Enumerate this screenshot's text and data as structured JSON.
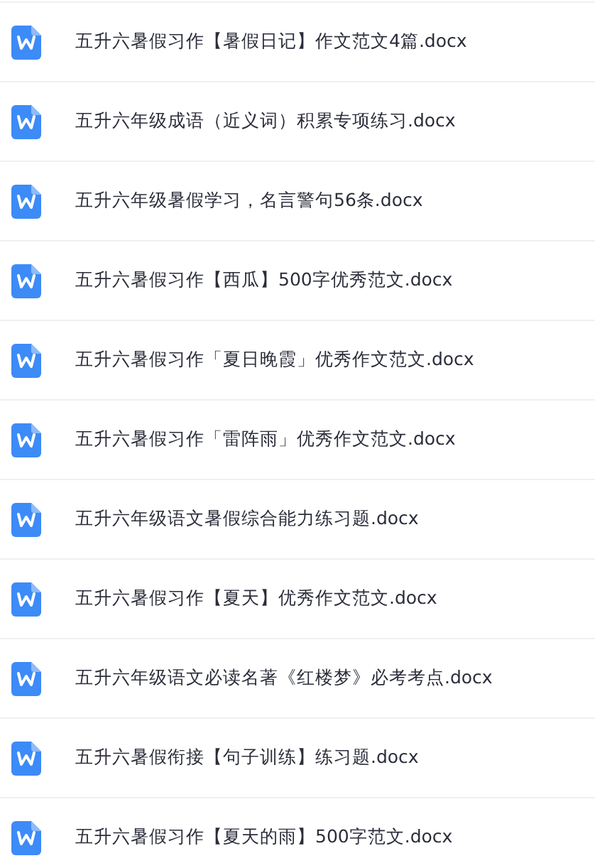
{
  "files": [
    {
      "name": "五升六暑假习作【暑假日记】作文范文4篇.docx"
    },
    {
      "name": "五升六年级成语（近义词）积累专项练习.docx"
    },
    {
      "name": "五升六年级暑假学习，名言警句56条.docx"
    },
    {
      "name": "五升六暑假习作【西瓜】500字优秀范文.docx"
    },
    {
      "name": "五升六暑假习作「夏日晚霞」优秀作文范文.docx"
    },
    {
      "name": "五升六暑假习作「雷阵雨」优秀作文范文.docx"
    },
    {
      "name": "五升六年级语文暑假综合能力练习题.docx"
    },
    {
      "name": "五升六暑假习作【夏天】优秀作文范文.docx"
    },
    {
      "name": "五升六年级语文必读名著《红楼梦》必考考点.docx"
    },
    {
      "name": "五升六暑假衔接【句子训练】练习题.docx"
    },
    {
      "name": "五升六暑假习作【夏天的雨】500字范文.docx"
    }
  ]
}
